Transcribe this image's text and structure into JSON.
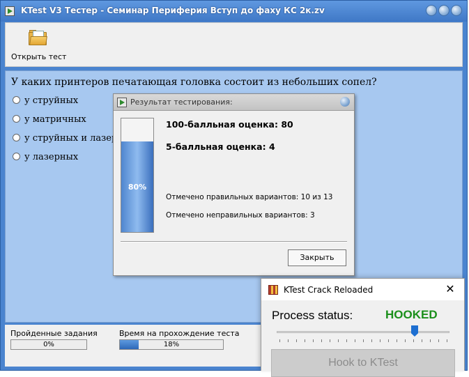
{
  "main_window": {
    "title": "KTest V3 Тестер - Семинар Периферия Вступ до фаху КС 2к.zv",
    "toolbar": {
      "open_test_label": "Открыть тест"
    },
    "question": "У каких принтеров печатающая головка состоит из небольших сопел?",
    "options": [
      {
        "label": "у струйных",
        "selected": false
      },
      {
        "label": "у матричных",
        "selected": false
      },
      {
        "label": "у струйных и лазерных",
        "selected": false
      },
      {
        "label": "у лазерных",
        "selected": false
      }
    ],
    "status": {
      "completed_label": "Пройденные задания",
      "completed_value": "0%",
      "completed_fraction": 0,
      "time_label": "Время на прохождение теста",
      "time_value": "18%",
      "time_fraction": 0.18
    }
  },
  "result_dialog": {
    "title": "Результат тестирования:",
    "progress_label": "80%",
    "progress_fraction": 0.8,
    "score_100": "100-балльная оценка: 80",
    "score_5": "5-балльная оценка: 4",
    "correct_marked": "Отмечено правильных вариантов: 10 из 13",
    "incorrect_marked": "Отмечено неправильных вариантов: 3",
    "close_label": "Закрыть"
  },
  "crack_window": {
    "title": "KTest Crack Reloaded",
    "close_glyph": "✕",
    "process_label": "Process status:",
    "process_value": "HOOKED",
    "process_color": "#1b8f1b",
    "slider_fraction": 0.8,
    "hook_button_label": "Hook to KTest"
  },
  "colors": {
    "title_blue": "#4a84cf",
    "content_blue": "#a7c8f0",
    "progress_blue": "#3a6fbd"
  }
}
